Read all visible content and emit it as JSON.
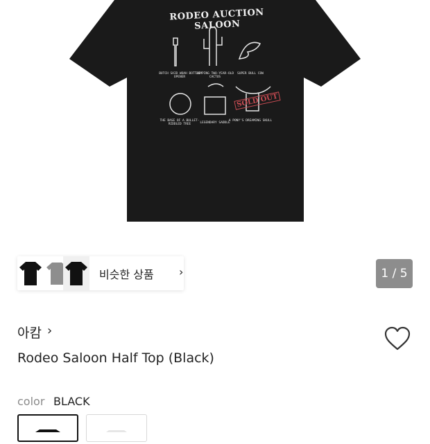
{
  "product_image": {
    "print_title": "RODEO AUCTION SALOON",
    "stamp": "SOLD OUT",
    "captions": [
      "BUTCH SAID WOAH BOTTLE OPENER",
      "JUMPING TWO-YEAR-OLD CACTUS",
      "SUPER BULL COW",
      "THE BASE OF A BULLET-RIDDLED TREE",
      "LEGENDARY SADDLE",
      "A PONY'S DREAMING SKULL"
    ]
  },
  "similar_products": {
    "label": "비슷한 상품",
    "chevron": "›"
  },
  "image_counter": "1 / 5",
  "brand": {
    "name": "아캄",
    "chevron": "›"
  },
  "product": {
    "name": "Rodeo Saloon Half Top (Black)"
  },
  "color": {
    "label": "color",
    "value": "BLACK"
  },
  "colors": {
    "shirt": "#1a1a1a",
    "counter_bg": "#8d8d8d",
    "stamp": "#c74b52"
  }
}
